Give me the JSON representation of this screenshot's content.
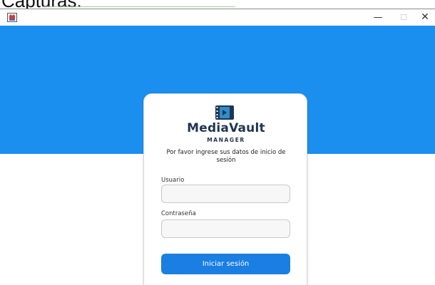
{
  "caption": {
    "text": "Capturas:"
  },
  "window": {
    "controls": {
      "minimize": "—",
      "maximize": "☐",
      "close": "✕"
    }
  },
  "login": {
    "brand_name": "MediaVault",
    "brand_tagline": "MANAGER",
    "instructions": "Por favor ingrese sus datos de inicio de sesión",
    "username_label": "Usuario",
    "username_value": "",
    "password_label": "Contraseña",
    "password_value": "",
    "submit_label": "Iniciar sesión"
  },
  "colors": {
    "header_band": "#1a8ff0",
    "primary_button": "#1a7ee3",
    "brand_text": "#1f3552"
  },
  "icons": {
    "app": "java-app-icon",
    "logo": "video-play-icon"
  }
}
